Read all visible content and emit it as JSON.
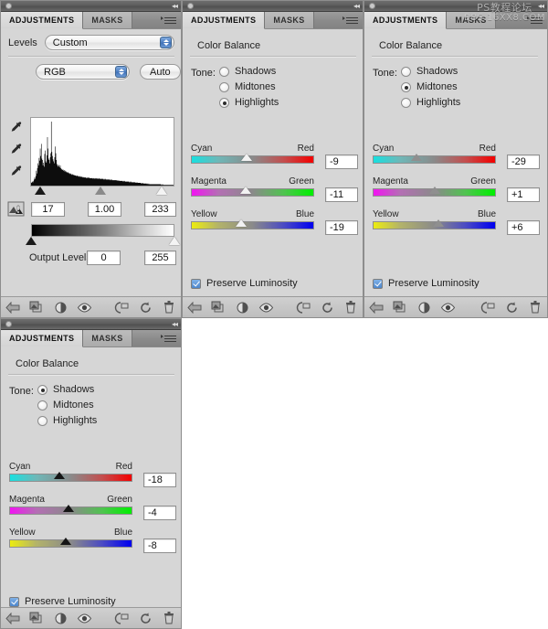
{
  "watermark": {
    "line1": "PS教程论坛",
    "line2": "BBS.16XX8.COM"
  },
  "panels": {
    "levels": {
      "tabs": {
        "active": "ADJUSTMENTS",
        "inactive": "MASKS"
      },
      "title": "Levels",
      "preset": "Custom",
      "channel": "RGB",
      "auto_label": "Auto",
      "input_shadow": "17",
      "input_gamma": "1.00",
      "input_highlight": "233",
      "output_label": "Output Levels:",
      "output_shadow": "0",
      "output_highlight": "255",
      "eyedroppers": [
        "set-black-point",
        "set-gray-point",
        "set-white-point"
      ],
      "input_thumb_pct": [
        6.7,
        49.0,
        91.4
      ],
      "output_thumb_pct": [
        0.0,
        100.0
      ],
      "histogram": [
        4,
        5,
        6,
        5,
        7,
        9,
        12,
        10,
        14,
        22,
        18,
        26,
        33,
        30,
        41,
        37,
        55,
        44,
        62,
        40,
        38,
        30,
        34,
        28,
        47,
        52,
        36,
        34,
        45,
        72,
        55,
        40,
        38,
        33,
        42,
        48,
        95,
        50,
        44,
        39,
        36,
        33,
        42,
        58,
        48,
        38,
        32,
        30,
        28,
        31,
        29,
        27,
        30,
        26,
        24,
        25,
        23,
        24,
        22,
        23,
        21,
        22,
        20,
        21,
        20,
        19,
        20,
        18,
        19,
        18,
        17,
        18,
        17,
        16,
        17,
        16,
        16,
        15,
        16,
        15,
        15,
        14,
        15,
        14,
        14,
        14,
        13,
        14,
        13,
        13,
        13,
        13,
        12,
        13,
        12,
        12,
        12,
        12,
        12,
        11,
        12,
        11,
        12,
        11,
        12,
        11,
        11,
        11,
        11,
        11,
        11,
        10,
        11,
        11,
        10,
        11,
        10,
        11,
        10,
        11,
        10,
        10,
        11,
        10,
        10,
        10,
        10,
        10,
        10,
        10,
        9,
        10,
        9,
        10,
        9,
        9,
        9,
        9,
        9,
        9,
        9,
        9,
        8,
        9,
        8,
        9,
        8,
        8,
        8,
        8,
        8,
        8,
        8,
        8,
        7,
        8,
        7,
        8,
        7,
        7,
        7,
        7,
        7,
        7,
        7,
        6,
        7,
        6,
        7,
        6,
        6,
        6,
        6,
        6,
        6,
        6,
        5,
        6,
        5,
        6,
        5,
        5,
        5,
        5,
        5,
        5,
        5,
        4,
        5,
        4,
        5,
        4,
        4,
        4,
        4,
        4,
        4,
        3,
        4,
        3,
        4,
        3,
        3,
        3,
        3,
        3,
        3,
        3,
        2,
        3,
        2,
        3,
        2,
        2,
        2,
        2,
        2,
        2,
        2,
        2,
        2,
        2,
        2,
        2,
        2,
        2,
        2,
        2,
        2,
        2,
        2,
        2,
        2,
        1,
        2,
        1,
        2,
        1,
        1,
        1,
        1,
        1,
        1,
        1,
        1,
        1,
        1,
        1,
        1,
        1,
        1,
        1,
        1,
        1,
        1,
        1,
        1,
        1,
        1
      ],
      "footer_icons": [
        "return-to-adjustment-list",
        "clip-to-layer",
        "toggle-adjustment",
        "toggle-layer-visibility",
        "view-previous-state",
        "reset-adjustment",
        "delete-adjustment"
      ]
    },
    "cb_highlights": {
      "tabs": {
        "active": "ADJUSTMENTS",
        "inactive": "MASKS"
      },
      "title": "Color Balance",
      "tone_label": "Tone:",
      "tones": [
        {
          "label": "Shadows",
          "selected": false
        },
        {
          "label": "Midtones",
          "selected": false
        },
        {
          "label": "Highlights",
          "selected": true
        }
      ],
      "sliders": [
        {
          "left": "Cyan",
          "right": "Red",
          "value": "-9",
          "pct": 45.5,
          "thumb": "white"
        },
        {
          "left": "Magenta",
          "right": "Green",
          "value": "-11",
          "pct": 44.5,
          "thumb": "white"
        },
        {
          "left": "Yellow",
          "right": "Blue",
          "value": "-19",
          "pct": 40.5,
          "thumb": "white"
        }
      ],
      "preserve_label": "Preserve Luminosity",
      "preserve_checked": true
    },
    "cb_midtones": {
      "tabs": {
        "active": "ADJUSTMENTS",
        "inactive": "MASKS"
      },
      "title": "Color Balance",
      "tone_label": "Tone:",
      "tones": [
        {
          "label": "Shadows",
          "selected": false
        },
        {
          "label": "Midtones",
          "selected": true
        },
        {
          "label": "Highlights",
          "selected": false
        }
      ],
      "sliders": [
        {
          "left": "Cyan",
          "right": "Red",
          "value": "-29",
          "pct": 35.5,
          "thumb": "gray"
        },
        {
          "left": "Magenta",
          "right": "Green",
          "value": "+1",
          "pct": 50.5,
          "thumb": "gray"
        },
        {
          "left": "Yellow",
          "right": "Blue",
          "value": "+6",
          "pct": 53.0,
          "thumb": "gray"
        }
      ],
      "preserve_label": "Preserve Luminosity",
      "preserve_checked": true
    },
    "cb_shadows": {
      "tabs": {
        "active": "ADJUSTMENTS",
        "inactive": "MASKS"
      },
      "title": "Color Balance",
      "tone_label": "Tone:",
      "tones": [
        {
          "label": "Shadows",
          "selected": true
        },
        {
          "label": "Midtones",
          "selected": false
        },
        {
          "label": "Highlights",
          "selected": false
        }
      ],
      "sliders": [
        {
          "left": "Cyan",
          "right": "Red",
          "value": "-18",
          "pct": 41.0,
          "thumb": "black"
        },
        {
          "left": "Magenta",
          "right": "Green",
          "value": "-4",
          "pct": 48.0,
          "thumb": "black"
        },
        {
          "left": "Yellow",
          "right": "Blue",
          "value": "-8",
          "pct": 46.0,
          "thumb": "black"
        }
      ],
      "preserve_label": "Preserve Luminosity",
      "preserve_checked": true
    }
  }
}
